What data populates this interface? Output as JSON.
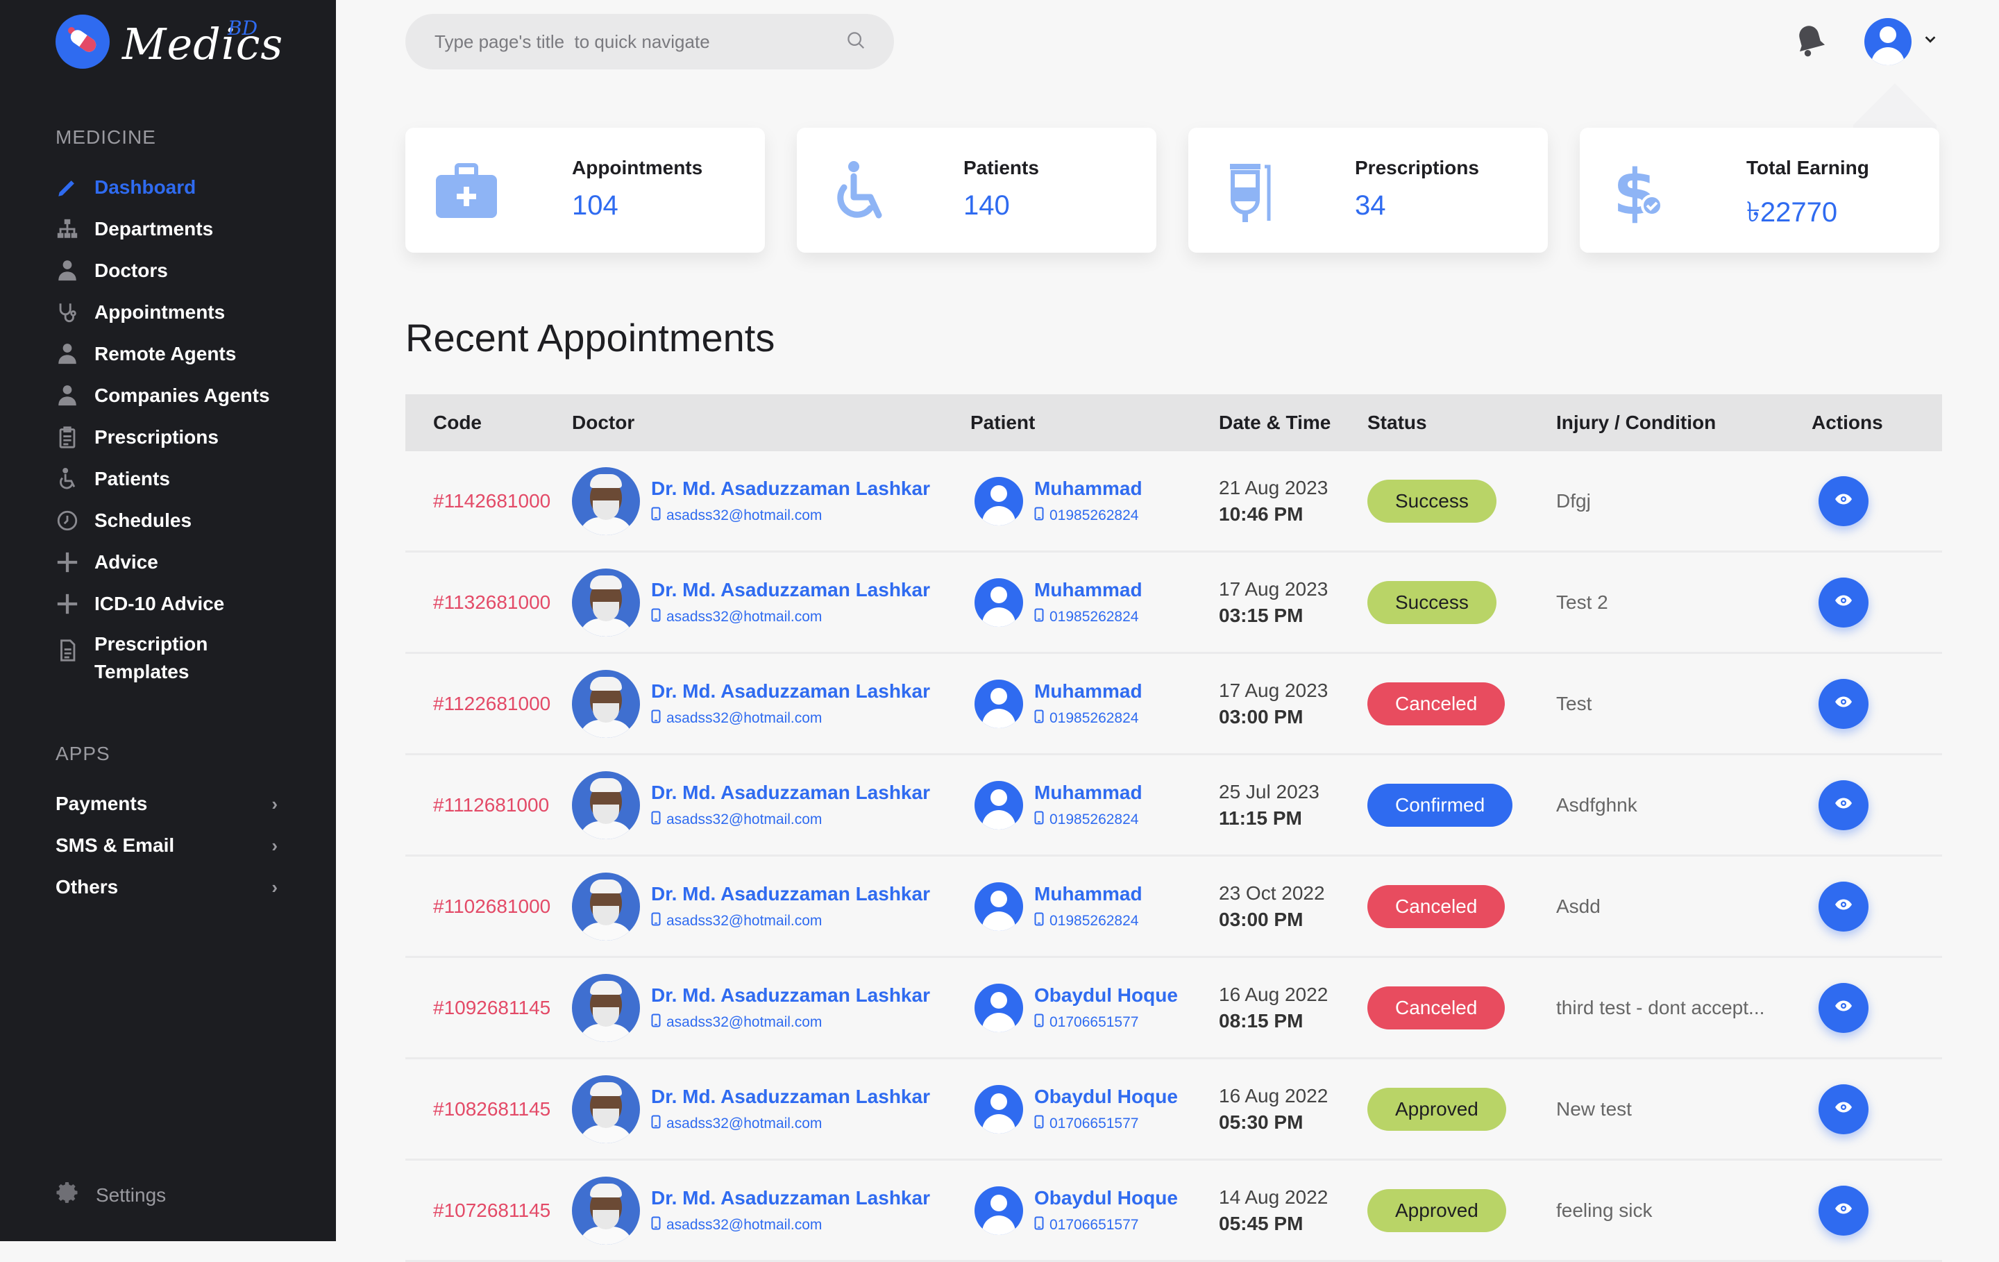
{
  "brand": {
    "name": "Medics",
    "sup": "BD"
  },
  "sidebar": {
    "section_medicine": "MEDICINE",
    "items": [
      {
        "label": "Dashboard",
        "icon": "pencil-icon",
        "active": true
      },
      {
        "label": "Departments",
        "icon": "org-chart-icon"
      },
      {
        "label": "Doctors",
        "icon": "doctor-icon"
      },
      {
        "label": "Appointments",
        "icon": "stethoscope-icon"
      },
      {
        "label": "Remote Agents",
        "icon": "agent-icon"
      },
      {
        "label": "Companies Agents",
        "icon": "agent-icon"
      },
      {
        "label": "Prescriptions",
        "icon": "clipboard-icon"
      },
      {
        "label": "Patients",
        "icon": "wheelchair-icon"
      },
      {
        "label": "Schedules",
        "icon": "clock-icon"
      },
      {
        "label": "Advice",
        "icon": "plus-icon"
      },
      {
        "label": "ICD-10 Advice",
        "icon": "plus-icon"
      },
      {
        "label": "Prescription Templates",
        "icon": "document-icon"
      }
    ],
    "section_apps": "APPS",
    "apps": [
      {
        "label": "Payments"
      },
      {
        "label": "SMS & Email"
      },
      {
        "label": "Others"
      }
    ],
    "settings_label": "Settings"
  },
  "search": {
    "placeholder": "Type page's title  to quick navigate"
  },
  "cards": [
    {
      "label": "Appointments",
      "value": "104",
      "icon": "medical-kit-icon"
    },
    {
      "label": "Patients",
      "value": "140",
      "icon": "wheelchair-icon"
    },
    {
      "label": "Prescriptions",
      "value": "34",
      "icon": "iv-bag-icon"
    },
    {
      "label": "Total Earning",
      "value": "৳22770",
      "icon": "dollar-icon"
    }
  ],
  "section_title": "Recent Appointments",
  "table": {
    "headers": [
      "Code",
      "Doctor",
      "Patient",
      "Date & Time",
      "Status",
      "Injury / Condition",
      "Actions"
    ],
    "rows": [
      {
        "code": "#1142681000",
        "doctor": "Dr. Md. Asaduzzaman Lashkar",
        "doctor_email": "asadss32@hotmail.com",
        "patient": "Muhammad",
        "patient_phone": "01985262824",
        "date": "21 Aug 2023",
        "time": "10:46 PM",
        "status": "Success",
        "status_type": "success",
        "injury": "Dfgj"
      },
      {
        "code": "#1132681000",
        "doctor": "Dr. Md. Asaduzzaman Lashkar",
        "doctor_email": "asadss32@hotmail.com",
        "patient": "Muhammad",
        "patient_phone": "01985262824",
        "date": "17 Aug 2023",
        "time": "03:15 PM",
        "status": "Success",
        "status_type": "success",
        "injury": "Test 2"
      },
      {
        "code": "#1122681000",
        "doctor": "Dr. Md. Asaduzzaman Lashkar",
        "doctor_email": "asadss32@hotmail.com",
        "patient": "Muhammad",
        "patient_phone": "01985262824",
        "date": "17 Aug 2023",
        "time": "03:00 PM",
        "status": "Canceled",
        "status_type": "canceled",
        "injury": "Test"
      },
      {
        "code": "#1112681000",
        "doctor": "Dr. Md. Asaduzzaman Lashkar",
        "doctor_email": "asadss32@hotmail.com",
        "patient": "Muhammad",
        "patient_phone": "01985262824",
        "date": "25 Jul 2023",
        "time": "11:15 PM",
        "status": "Confirmed",
        "status_type": "confirmed",
        "injury": "Asdfghnk"
      },
      {
        "code": "#1102681000",
        "doctor": "Dr. Md. Asaduzzaman Lashkar",
        "doctor_email": "asadss32@hotmail.com",
        "patient": "Muhammad",
        "patient_phone": "01985262824",
        "date": "23 Oct 2022",
        "time": "03:00 PM",
        "status": "Canceled",
        "status_type": "canceled",
        "injury": "Asdd"
      },
      {
        "code": "#1092681145",
        "doctor": "Dr. Md. Asaduzzaman Lashkar",
        "doctor_email": "asadss32@hotmail.com",
        "patient": "Obaydul Hoque",
        "patient_phone": "01706651577",
        "date": "16 Aug 2022",
        "time": "08:15 PM",
        "status": "Canceled",
        "status_type": "canceled",
        "injury": "third test - dont accept..."
      },
      {
        "code": "#1082681145",
        "doctor": "Dr. Md. Asaduzzaman Lashkar",
        "doctor_email": "asadss32@hotmail.com",
        "patient": "Obaydul Hoque",
        "patient_phone": "01706651577",
        "date": "16 Aug 2022",
        "time": "05:30 PM",
        "status": "Approved",
        "status_type": "approved",
        "injury": "New test"
      },
      {
        "code": "#1072681145",
        "doctor": "Dr. Md. Asaduzzaman Lashkar",
        "doctor_email": "asadss32@hotmail.com",
        "patient": "Obaydul Hoque",
        "patient_phone": "01706651577",
        "date": "14 Aug 2022",
        "time": "05:45 PM",
        "status": "Approved",
        "status_type": "approved",
        "injury": "feeling sick"
      }
    ]
  },
  "colors": {
    "accent": "#2f6bf0",
    "code": "#e34a67",
    "success": "#b9d467",
    "canceled": "#e84c5f",
    "sidebar": "#1c1d21"
  }
}
